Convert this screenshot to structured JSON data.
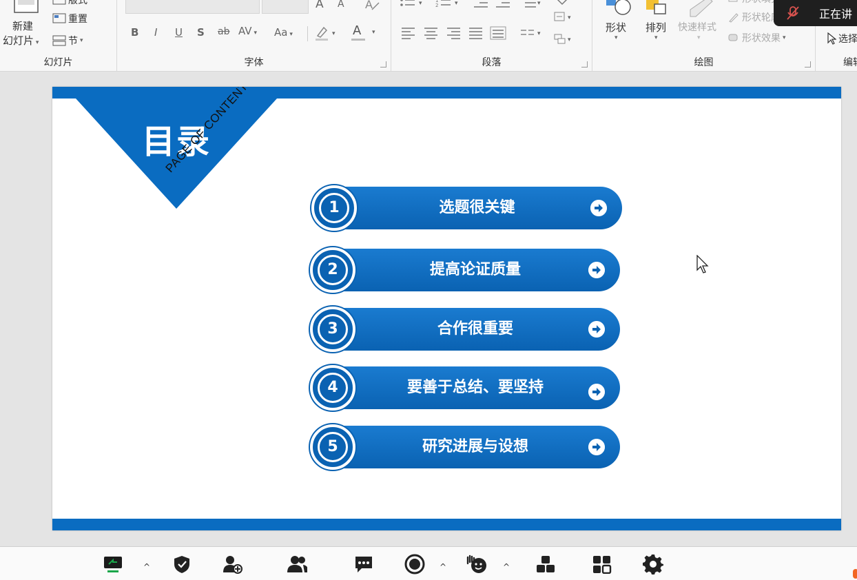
{
  "ribbon": {
    "slides_group": {
      "new_slide_label_1": "新建",
      "new_slide_label_2": "幻灯片",
      "reset_label": "重置",
      "section_label": "节",
      "layout_label": "版式",
      "group_label": "幻灯片"
    },
    "font_group": {
      "bold": "B",
      "italic": "I",
      "underline": "U",
      "shadow": "S",
      "strike": "ab",
      "spacing": "AV",
      "case": "Aa",
      "grow": "A",
      "shrink": "A",
      "font_color": "A",
      "group_label": "字体"
    },
    "paragraph_group": {
      "group_label": "段落"
    },
    "drawing_group": {
      "shapes_label": "形状",
      "arrange_label": "排列",
      "quick_styles_label": "快速样式",
      "shape_fill_label": "形状填充",
      "shape_outline_label": "形状轮廓",
      "shape_effects_label": "形状效果",
      "group_label": "绘图"
    },
    "editing_group": {
      "select_label": "选择",
      "group_label": "编辑"
    }
  },
  "overlay": {
    "speaking_label": "正在讲"
  },
  "slide": {
    "title": "目录",
    "subtitle": "PAGE OF CONTENT",
    "items": [
      {
        "number": "1",
        "label": "选题很关键"
      },
      {
        "number": "2",
        "label": "提高论证质量"
      },
      {
        "number": "3",
        "label": "合作很重要"
      },
      {
        "number": "4",
        "label": "要善于总结、要坚持"
      },
      {
        "number": "5",
        "label": "研究进展与设想"
      }
    ]
  },
  "colors": {
    "accent": "#0a6cc1",
    "share_green": "#1aa64a"
  },
  "toolbar": {
    "icons": [
      "share-screen-icon",
      "security-icon",
      "invite-icon",
      "participants-icon",
      "chat-icon",
      "record-icon",
      "reactions-icon",
      "apps-icon",
      "whiteboard-icon",
      "settings-icon"
    ]
  }
}
